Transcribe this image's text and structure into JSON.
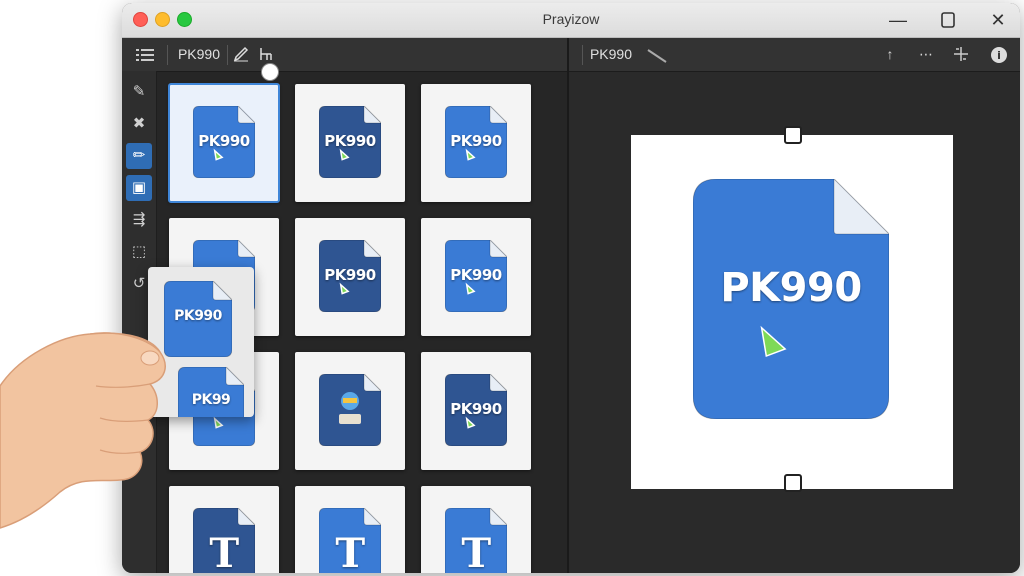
{
  "window": {
    "title": "Prayizow"
  },
  "toolbar": {
    "left_label": "PK990",
    "right_label": "PK990"
  },
  "tools": [
    {
      "icon": "pencil-icon"
    },
    {
      "icon": "cross-arrows-icon"
    },
    {
      "icon": "brush-icon"
    },
    {
      "icon": "select-tool-icon"
    },
    {
      "icon": "transform-icon"
    },
    {
      "icon": "crop-corners-icon"
    },
    {
      "icon": "rotate-icon"
    }
  ],
  "grid": {
    "thumbnails": [
      {
        "label": "PK990",
        "style": "blue"
      },
      {
        "label": "PK990",
        "style": "navy"
      },
      {
        "label": "PK990",
        "style": "blue"
      },
      {
        "label": "PK990",
        "style": "blue"
      },
      {
        "label": "PK990",
        "style": "navy"
      },
      {
        "label": "PK990",
        "style": "blue"
      },
      {
        "label": "PK990",
        "style": "blue"
      },
      {
        "label": "",
        "style": "navy-figure"
      },
      {
        "label": "PK990",
        "style": "navy"
      },
      {
        "label": "T",
        "style": "navy-t"
      },
      {
        "label": "T",
        "style": "blue-t"
      },
      {
        "label": "T",
        "style": "blue-t"
      }
    ],
    "selected_index": 0
  },
  "preview": {
    "label": "PK990"
  },
  "dragged_card": {
    "top_label": "PK990",
    "bottom_label": "PK99"
  },
  "colors": {
    "icon_blue": "#3a7bd5",
    "icon_navy": "#2f5592",
    "accent": "#2f6db5"
  }
}
